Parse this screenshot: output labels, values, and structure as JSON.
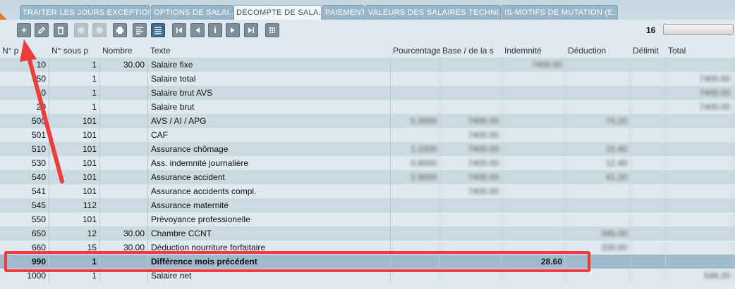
{
  "tabs": [
    {
      "label": "TRAITER LES JOURS EXCEPTION..."
    },
    {
      "label": "OPTIONS DE SALAI..."
    },
    {
      "label": "DÉCOMPTE DE SALA..."
    },
    {
      "label": "PAIEMENT"
    },
    {
      "label": "VALEURS DES SALAIRES TECHNI..."
    },
    {
      "label": "IS-MOTIFS DE MUTATION (E..."
    }
  ],
  "toolbar": {
    "add": "+",
    "edit_icon": "pencil-icon",
    "delete_icon": "trash-icon",
    "record_count": "16",
    "info": "i"
  },
  "columns": {
    "no_p": "N° p",
    "no_sous": "N° sous p",
    "nombre": "Nombre",
    "texte": "Texte",
    "pourcentage": "Pourcentage",
    "base": "Base / de la s",
    "indemnite": "Indemnité",
    "deduction": "Déduction",
    "delimit": "Délimit",
    "total": "Total"
  },
  "rows": [
    {
      "no": "10",
      "sous": "1",
      "nombre": "30.00",
      "texte": "Salaire fixe",
      "pct": "",
      "base": "",
      "ind": "7400.00",
      "ded": "",
      "del": "",
      "tot": ""
    },
    {
      "no": "50",
      "sous": "1",
      "nombre": "",
      "texte": "Salaire total",
      "pct": "",
      "base": "",
      "ind": "",
      "ded": "",
      "del": "",
      "tot": "7400.00"
    },
    {
      "no": "40",
      "sous": "1",
      "nombre": "",
      "texte": "Salaire brut AVS",
      "pct": "",
      "base": "",
      "ind": "",
      "ded": "",
      "del": "",
      "tot": "7400.00"
    },
    {
      "no": "20",
      "sous": "1",
      "nombre": "",
      "texte": "Salaire brut",
      "pct": "",
      "base": "",
      "ind": "",
      "ded": "",
      "del": "",
      "tot": "7400.00"
    },
    {
      "no": "500",
      "sous": "101",
      "nombre": "",
      "texte": "AVS / AI / APG",
      "pct": "5.3000",
      "base": "7400.00",
      "ind": "",
      "ded": "74.20",
      "del": "",
      "tot": ""
    },
    {
      "no": "501",
      "sous": "101",
      "nombre": "",
      "texte": "CAF",
      "pct": "",
      "base": "7400.00",
      "ind": "",
      "ded": "",
      "del": "",
      "tot": ""
    },
    {
      "no": "510",
      "sous": "101",
      "nombre": "",
      "texte": "Assurance chômage",
      "pct": "1.1000",
      "base": "7400.00",
      "ind": "",
      "ded": "15.40",
      "del": "",
      "tot": ""
    },
    {
      "no": "530",
      "sous": "101",
      "nombre": "",
      "texte": "Ass. indemnité journalière",
      "pct": "0.8000",
      "base": "7400.00",
      "ind": "",
      "ded": "12.40",
      "del": "",
      "tot": ""
    },
    {
      "no": "540",
      "sous": "101",
      "nombre": "",
      "texte": "Assurance accident",
      "pct": "2.9000",
      "base": "7400.00",
      "ind": "",
      "ded": "41.20",
      "del": "",
      "tot": ""
    },
    {
      "no": "541",
      "sous": "101",
      "nombre": "",
      "texte": "Assurance accidents compl.",
      "pct": "",
      "base": "7400.00",
      "ind": "",
      "ded": "",
      "del": "",
      "tot": ""
    },
    {
      "no": "545",
      "sous": "112",
      "nombre": "",
      "texte": "Assurance maternité",
      "pct": "",
      "base": "",
      "ind": "",
      "ded": "",
      "del": "",
      "tot": ""
    },
    {
      "no": "550",
      "sous": "101",
      "nombre": "",
      "texte": "Prévoyance professionelle",
      "pct": "",
      "base": "",
      "ind": "",
      "ded": "",
      "del": "",
      "tot": ""
    },
    {
      "no": "650",
      "sous": "12",
      "nombre": "30.00",
      "texte": "Chambre CCNT",
      "pct": "",
      "base": "",
      "ind": "",
      "ded": "345.00",
      "del": "",
      "tot": ""
    },
    {
      "no": "660",
      "sous": "15",
      "nombre": "30.00",
      "texte": "Déduction nourriture forfaitaire",
      "pct": "",
      "base": "",
      "ind": "",
      "ded": "330.00",
      "del": "",
      "tot": ""
    },
    {
      "no": "990",
      "sous": "1",
      "nombre": "",
      "texte": "Différence mois précédent",
      "pct": "",
      "base": "",
      "ind": "28.60",
      "ded": "",
      "del": "",
      "tot": ""
    },
    {
      "no": "1000",
      "sous": "1",
      "nombre": "",
      "texte": "Salaire net",
      "pct": "",
      "base": "",
      "ind": "",
      "ded": "",
      "del": "",
      "tot": "548.20"
    }
  ],
  "colors": {
    "highlight": "#ee3b3b",
    "selected_row": "#9fbacb",
    "tab_bg": "#97b7c9"
  }
}
